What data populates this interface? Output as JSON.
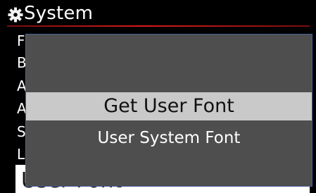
{
  "header": {
    "title": "System",
    "icon": "gear-icon"
  },
  "background_menu": {
    "items": [
      "F",
      "B",
      "A",
      "A",
      "S",
      "L"
    ],
    "selected_label": "User Font"
  },
  "popup": {
    "options": [
      {
        "label": "Get User Font",
        "highlighted": true
      },
      {
        "label": "User System Font",
        "highlighted": false
      }
    ]
  },
  "colors": {
    "background": "#000000",
    "title_rule": "#d81c1c",
    "popup_fill": "#4e4e4e",
    "popup_border": "#4a5f9a",
    "highlight": "#c9c9c9",
    "selected_row": "#ffffff"
  }
}
